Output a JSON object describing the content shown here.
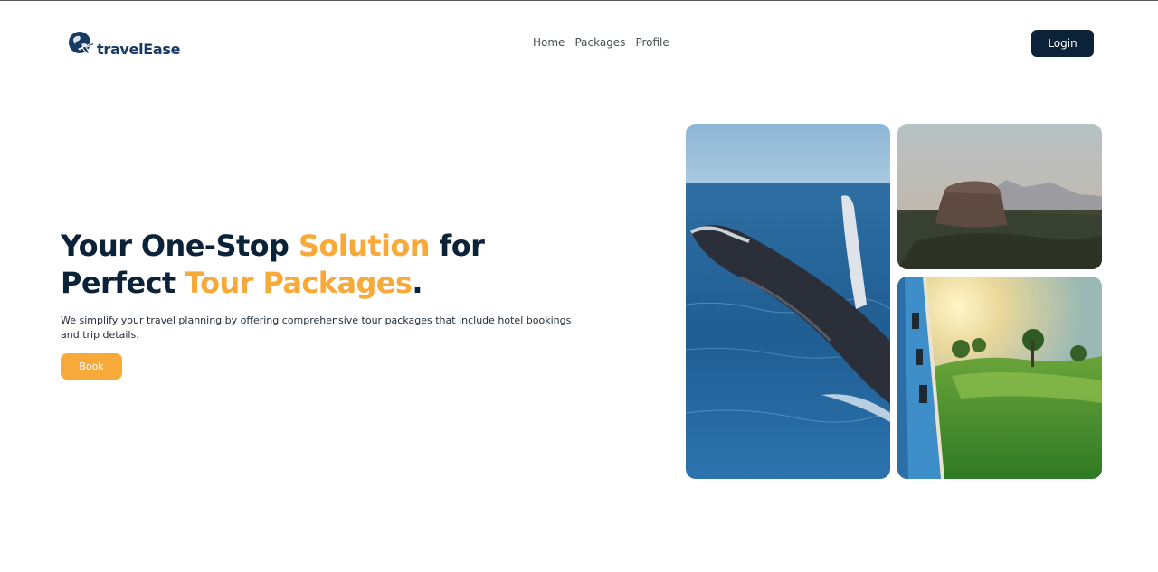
{
  "header": {
    "brand": "travelEase",
    "brand_icon": "globe-plane-icon",
    "nav": [
      {
        "label": "Home"
      },
      {
        "label": "Packages"
      },
      {
        "label": "Profile"
      }
    ],
    "login_label": "Login"
  },
  "hero": {
    "title_part1": "Your One-Stop ",
    "title_accent1": "Solution",
    "title_part2": " for",
    "title_part3": "Perfect ",
    "title_accent2": "Tour Packages",
    "title_end": ".",
    "description": "We simplify your travel planning by offering comprehensive tour packages that include hotel bookings and trip details.",
    "book_label": "Book"
  },
  "gallery": [
    {
      "subject": "breaching humpback whale in ocean"
    },
    {
      "subject": "rock fortress on hilltop at dusk"
    },
    {
      "subject": "blue train through green tea hills at sunrise"
    }
  ],
  "colors": {
    "navy": "#0b2238",
    "accent": "#f7a93a",
    "brand_blue": "#163a64"
  }
}
